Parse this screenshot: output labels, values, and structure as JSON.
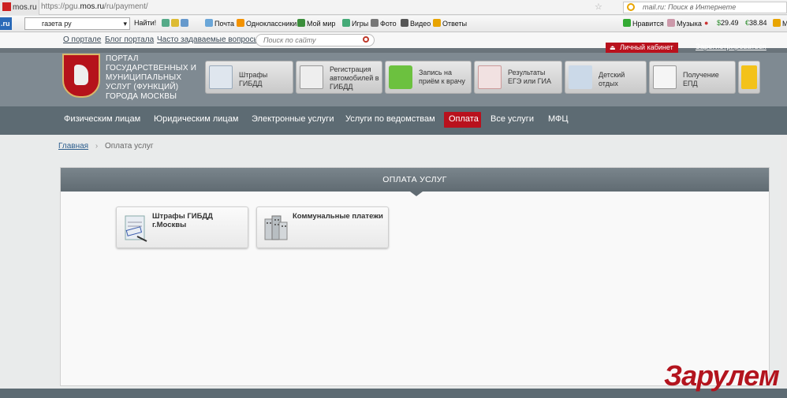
{
  "browser": {
    "tab_site": "mos.ru",
    "url_prefix": "https://pgu.",
    "url_host": "mos.ru",
    "url_path": "/ru/payment/",
    "search_placeholder": "mail.ru: Поиск в Интернете"
  },
  "toolbar": {
    "logo": ".ru",
    "search_value": "газета ру",
    "find_label": "Найти!",
    "items": [
      "Почта",
      "Одноклассники",
      "Мой мир",
      "Игры",
      "Фото",
      "Видео",
      "Ответы"
    ],
    "right_items": [
      "Нравится",
      "Музыка",
      "29.49",
      "38.84",
      "M"
    ]
  },
  "portal": {
    "top_links": [
      "О портале",
      "Блог портала",
      "Часто задаваемые вопросы"
    ],
    "search_placeholder": "Поиск по сайту",
    "cabinet_label": "Личный кабинет",
    "register_label": "Зарегистрироваться",
    "title": "ПОРТАЛ ГОСУДАРСТВЕННЫХ И МУНИЦИПАЛЬНЫХ УСЛУГ (ФУНКЦИЙ) ГОРОДА МОСКВЫ",
    "tiles": [
      "Штрафы ГИБДД",
      "Регистрация автомобилей в ГИБДД",
      "Запись на приём к врачу",
      "Результаты ЕГЭ или ГИА",
      "Детский отдых",
      "Получение ЕПД"
    ],
    "nav": [
      "Физическим лицам",
      "Юридическим лицам",
      "Электронные услуги",
      "Услуги по ведомствам",
      "Оплата",
      "Все услуги",
      "МФЦ"
    ],
    "breadcrumb_home": "Главная",
    "breadcrumb_sep": "›",
    "breadcrumb_current": "Оплата услуг",
    "panel_title": "ОПЛАТА УСЛУГ",
    "services": [
      "Штрафы ГИБДД г.Москвы",
      "Коммунальные платежи"
    ]
  },
  "watermark": "Зарулем",
  "colors": {
    "accent": "#b9111d",
    "header": "#7f8a92",
    "nav": "#5d6b73"
  }
}
